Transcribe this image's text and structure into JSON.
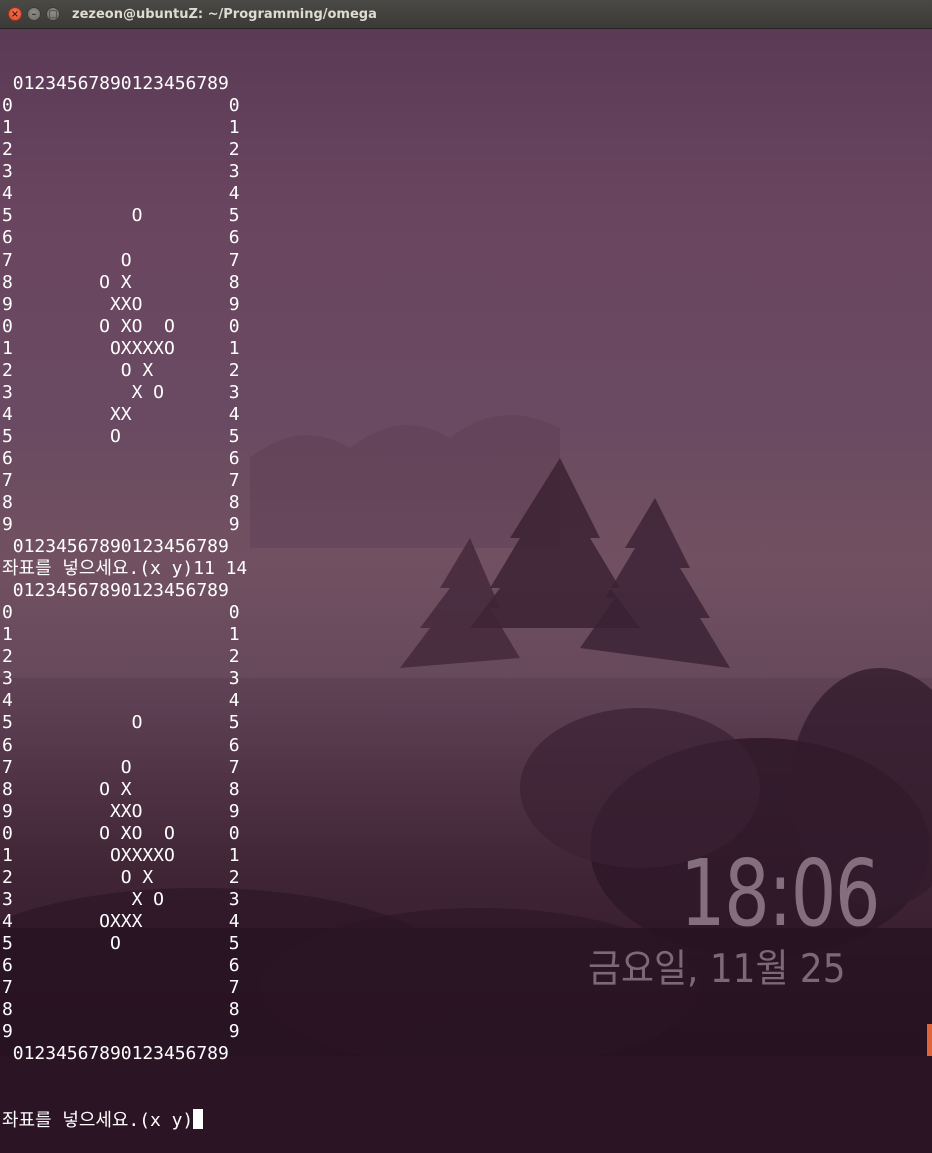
{
  "window": {
    "title": "zezeon@ubuntuZ: ~/Programming/omega",
    "close_icon": "×",
    "minimize_icon": "–",
    "maximize_icon": "□"
  },
  "terminal": {
    "lines": [
      " 01234567890123456789",
      "0                    0",
      "1                    1",
      "2                    2",
      "3                    3",
      "4                    4",
      "5           O        5",
      "6                    6",
      "7          O         7",
      "8        O X         8",
      "9         XXO        9",
      "0        O XO  O     0",
      "1         OXXXXO     1",
      "2          O X       2",
      "3           X O      3",
      "4         XX         4",
      "5         O          5",
      "6                    6",
      "7                    7",
      "8                    8",
      "9                    9",
      " 01234567890123456789",
      "좌표를 넣으세요.(x y)11 14",
      " 01234567890123456789",
      "0                    0",
      "1                    1",
      "2                    2",
      "3                    3",
      "4                    4",
      "5           O        5",
      "6                    6",
      "7          O         7",
      "8        O X         8",
      "9         XXO        9",
      "0        O XO  O     0",
      "1         OXXXXO     1",
      "2          O X       2",
      "3           X O      3",
      "4        OXXX        4",
      "5         O          5",
      "6                    6",
      "7                    7",
      "8                    8",
      "9                    9",
      " 01234567890123456789"
    ],
    "prompt": "좌표를 넣으세요.(x y)"
  },
  "lockscreen": {
    "time": "18:06",
    "date": "금요일, 11월 25"
  },
  "colors": {
    "titlebar": "#3b3a37",
    "terminal_text": "#ffffff",
    "close_button": "#e04a25"
  }
}
